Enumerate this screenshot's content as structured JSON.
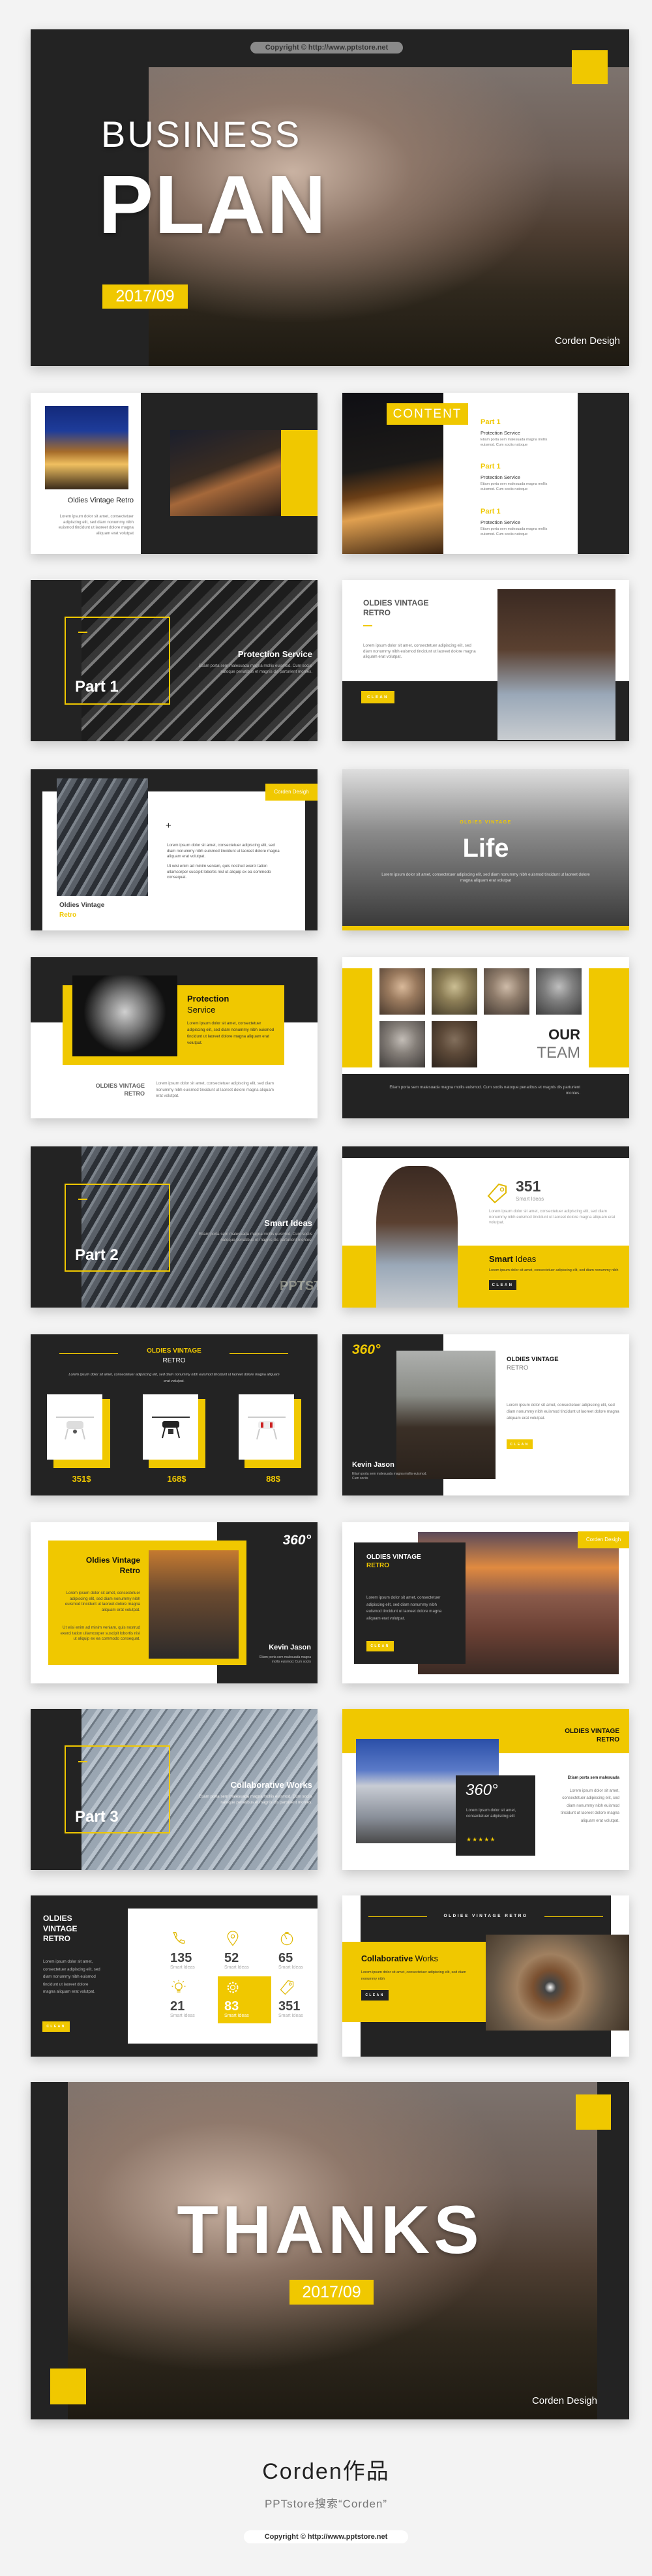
{
  "colors": {
    "accent": "#f0c800",
    "dark": "#232323",
    "background": "#f3f3f3"
  },
  "cover": {
    "copyright": "Copyright © http://www.pptstore.net",
    "title_1": "BUSINESS",
    "title_2": "PLAN",
    "date": "2017/09",
    "author": "Corden Desigh"
  },
  "slide_intro": {
    "title": "Oldies Vintage Retro",
    "body": "Lorem ipsum dolor sit amet, consectetuer adipiscing elit, sed diam nonummy nibh euismod tincidunt ut laoreet dolore magna aliquam erat volutpat"
  },
  "slide_content": {
    "heading": "CONTENT",
    "items": [
      {
        "part": "Part 1",
        "title": "Protection Service",
        "body": "Etiam porta sem malesuada magna mollis euismod. Cum sociis natoque"
      },
      {
        "part": "Part 1",
        "title": "Protection Service",
        "body": "Etiam porta sem malesuada magna mollis euismod. Cum sociis natoque"
      },
      {
        "part": "Part 1",
        "title": "Protection Service",
        "body": "Etiam porta sem malesuada magna mollis euismod. Cum sociis natoque"
      }
    ]
  },
  "slide_part1": {
    "part": "Part 1",
    "title": "Protection Service",
    "body": "Etiam porta sem malesuada magna mollis euismod. Cum sociis natoque penatibus et magnis dis parturient montes."
  },
  "slide_woman": {
    "title_1": "OLDIES VINTAGE",
    "title_2": "RETRO",
    "body": "Lorem ipsum dolor sit amet, consectetuer adipiscing elit, sed diam nonummy nibh euismod tincidunt ut laoreet dolore magna aliquam erat volutpat.",
    "button": "CLEAN"
  },
  "slide_phone": {
    "tag": "Corden Desigh",
    "plus": "+",
    "body_1": "Lorem ipsum dolor sit amet, consectetuer adipiscing elit, sed diam nonummy nibh euismod tincidunt ut laoreet dolore magna aliquam erat volutpat.",
    "body_2": "Ut wisi enim ad minim veniam, quis nostrud exerci tation ullamcorper suscipit lobortis nisl ut aliquip ex ea commodo consequat.",
    "title_1": "Oldies Vintage",
    "title_2": "Retro"
  },
  "slide_life": {
    "kicker": "OLDIES VINTAGE",
    "title": "Life",
    "body": "Lorem ipsum dolor sit amet, consectetuer adipiscing elit, sed diam nonummy nibh euismod tincidunt ut laoreet dolore magna aliquam erat volutpat"
  },
  "slide_protection": {
    "title_1": "Protection",
    "title_2": "Service",
    "body": "Lorem ipsum dolor sit amet, consectetuer adipiscing elit, sed diam nonummy nibh euismod tincidunt ut laoreet dolore magna aliquam erat volutpat.",
    "label_1": "OLDIES VINTAGE",
    "label_2": "RETRO",
    "body_2": "Lorem ipsum dolor sit amet, consectetuer adipiscing elit, sed diam nonummy nibh euismod tincidunt ut laoreet dolore magna aliquam erat volutpat."
  },
  "slide_team": {
    "title_1": "OUR",
    "title_2": "TEAM",
    "body": "Etiam porta sem malesuada magna mollis euismod. Cum sociis natoque penatibus et magnis dis parturient montes."
  },
  "slide_part2": {
    "part": "Part 2",
    "title": "Smart Ideas",
    "body": "Etiam porta sem malesuada magna mollis euismod. Cum sociis natoque penatibus et magnis dis parturient montes.",
    "watermark": "PPTSTORE"
  },
  "slide_smart": {
    "number": "351",
    "number_label": "Smart Ideas",
    "body": "Lorem ipsum dolor sit amet, consectetuer adipiscing elit, sed diam nonummy nibh euismod tincidunt ut laoreet dolore magna aliquam erat volutpat.",
    "title_1": "Smart",
    "title_2": "Ideas",
    "body_2": "Lorem ipsum dolor sit amet, consectetuer adipiscing elit, sed diam nonummy nibh",
    "button": "CLEAN"
  },
  "slide_products": {
    "title_1": "OLDIES VINTAGE",
    "title_2": "RETRO",
    "body": "Lorem ipsum dolor sit amet, consectetuer adipiscing elit, sed diam nonummy nibh euismod tincidunt ut laoreet dolore magna aliquam erat volutpat.",
    "prices": [
      "351$",
      "168$",
      "88$"
    ]
  },
  "slide_kevin": {
    "badge": "360°",
    "name": "Kevin Jason",
    "name_body": "Etiam porta sem malesuada magna mollis euismod. Cum sociis",
    "title_1": "OLDIES VINTAGE",
    "title_2": "RETRO",
    "body": "Lorem ipsum dolor sit amet, consectetuer adipiscing elit, sed diam nonummy nibh euismod tincidunt ut laoreet dolore magna aliquam erat volutpat.",
    "button": "CLEAN"
  },
  "slide_kevin2": {
    "title_1": "Oldies Vintage",
    "title_2": "Retro",
    "body_1": "Lorem ipsum dolor sit amet, consectetuer adipiscing elit, sed diam nonummy nibh euismod tincidunt ut laoreet dolore magna aliquam erat volutpat.",
    "body_2": "Ut wisi enim ad minim veniam, quis nostrud exerci tation ullamcorper suscipit lobortis nisl ut aliquip ex ea commodo consequat.",
    "badge": "360°",
    "name": "Kevin Jason",
    "name_body": "Etiam porta sem malesuada magna mollis euismod. Cum sociis"
  },
  "slide_city": {
    "tag": "Corden Desigh",
    "title_1": "OLDIES VINTAGE",
    "title_2": "RETRO",
    "body": "Lorem ipsum dolor sit amet, consectetuer adipiscing elit, sed diam nonummy nibh euismod tincidunt ut laoreet dolore magna aliquam erat volutpat.",
    "button": "CLEAN"
  },
  "slide_part3": {
    "part": "Part 3",
    "title": "Collaborative Works",
    "body": "Etiam porta sem malesuada magna mollis euismod. Cum sociis natoque penatibus et magnis dis parturient montes."
  },
  "slide_concert": {
    "title_1": "OLDIES VINTAGE",
    "title_2": "RETRO",
    "badge": "360°",
    "badge_body": "Lorem ipsum dolor sit amet, consectetuer adipiscing elit",
    "rating": 5,
    "aside_title": "Etiam porta sem malesuada",
    "aside_body": "Lorem ipsum dolor sit amet, consectetuer adipiscing elit, sed diam nonummy nibh euismod tincidunt ut laoreet dolore magna aliquam erat volutpat."
  },
  "slide_stats": {
    "title_1": "OLDIES",
    "title_2": "VINTAGE",
    "title_3": "RETRO",
    "body": "Lorem ipsum dolor sit amet, consectetuer adipiscing elit, sed diam nonummy nibh euismod tincidunt ut laoreet dolore magna aliquam erat volutpat.",
    "button": "CLEAN",
    "stats": [
      {
        "icon": "phone-icon",
        "value": "135",
        "label": "Smart Ideas",
        "highlighted": false
      },
      {
        "icon": "map-pin-icon",
        "value": "52",
        "label": "Smart Ideas",
        "highlighted": false
      },
      {
        "icon": "timer-icon",
        "value": "65",
        "label": "Smart Ideas",
        "highlighted": false
      },
      {
        "icon": "lightbulb-icon",
        "value": "21",
        "label": "Smart Ideas",
        "highlighted": false
      },
      {
        "icon": "gear-icon",
        "value": "83",
        "label": "Smart Ideas",
        "highlighted": true
      },
      {
        "icon": "tag-icon",
        "value": "351",
        "label": "Smart Ideas",
        "highlighted": false
      }
    ]
  },
  "slide_stairs": {
    "kicker": "OLDIES VINTAGE RETRO",
    "title_1": "Collaborative",
    "title_2": "Works",
    "body": "Lorem ipsum dolor sit amet, consectetuer adipiscing elit, sed diam nonummy nibh",
    "button": "CLEAN"
  },
  "thanks": {
    "title": "THANKS",
    "date": "2017/09",
    "author": "Corden Desigh"
  },
  "footer": {
    "brand": "Corden作品",
    "search": "PPTstore搜索“Corden”",
    "copyright": "Copyright © http://www.pptstore.net"
  }
}
